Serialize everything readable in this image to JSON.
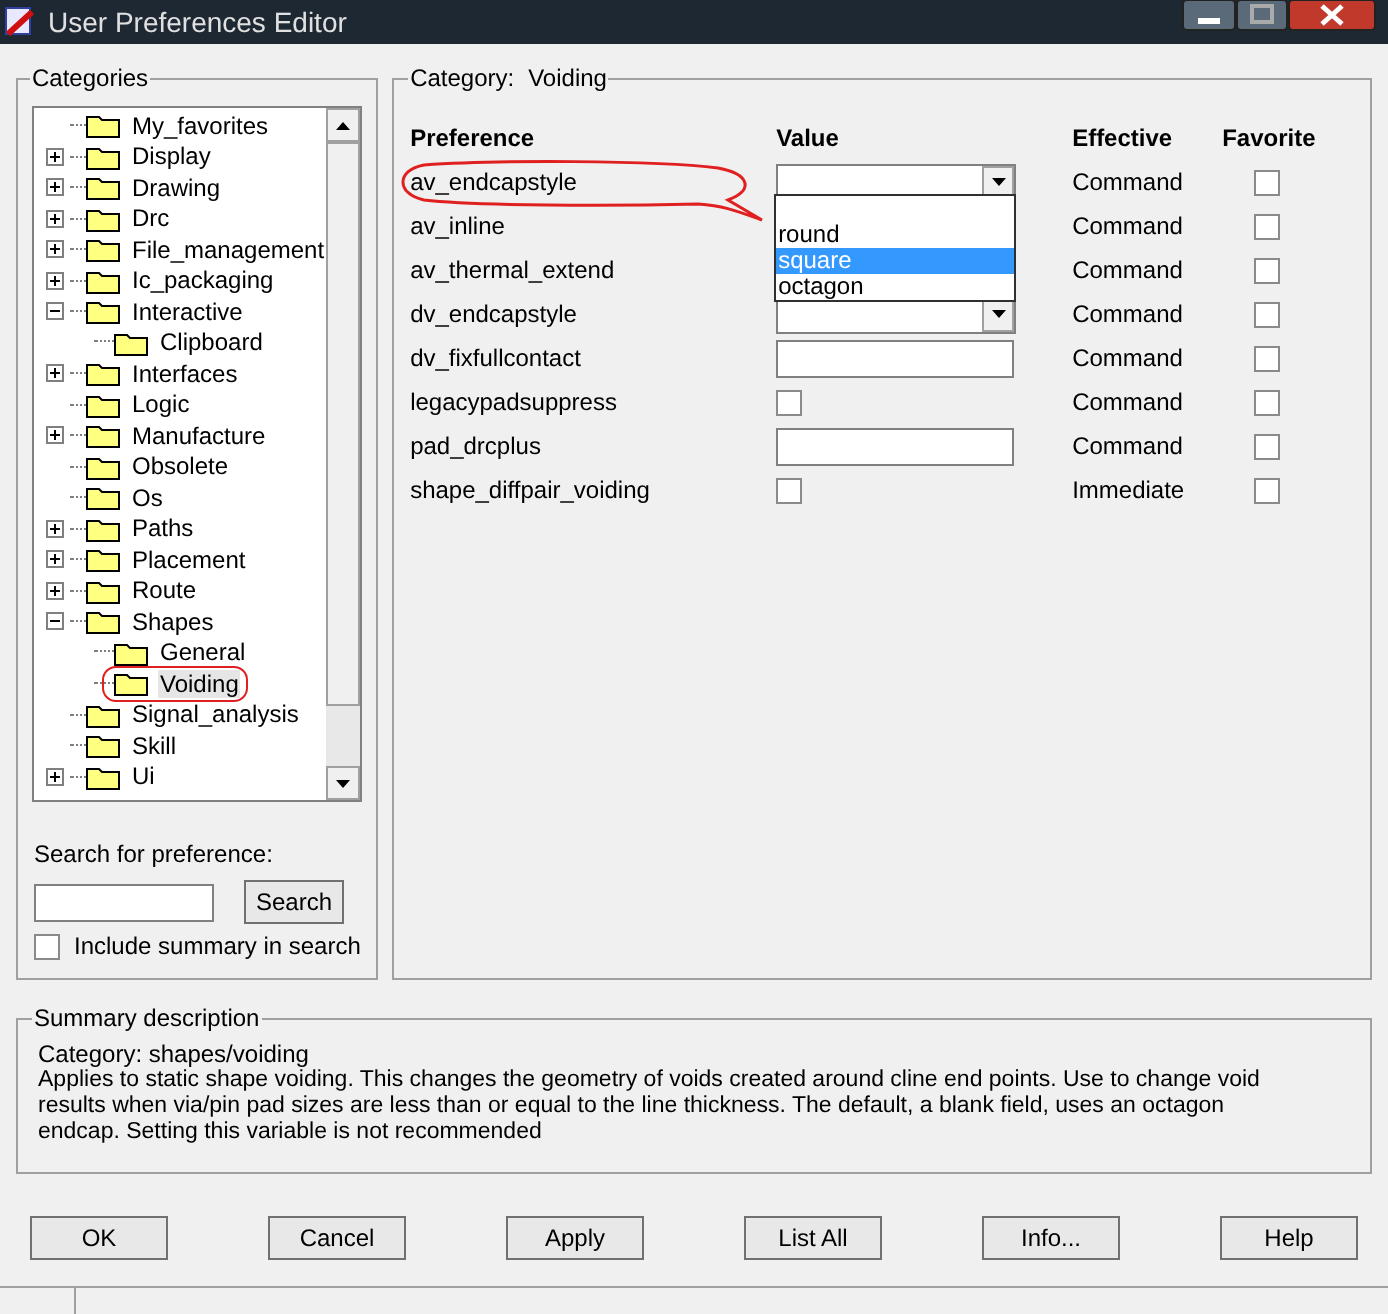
{
  "window": {
    "title": "User Preferences Editor"
  },
  "categories": {
    "title": "Categories",
    "tree": [
      {
        "label": "My_favorites",
        "selected": false
      },
      {
        "label": "Display",
        "expanded": false,
        "selected": false
      },
      {
        "label": "Drawing",
        "expanded": false,
        "selected": false
      },
      {
        "label": "Drc",
        "expanded": false,
        "selected": false
      },
      {
        "label": "File_management",
        "expanded": false,
        "selected": false
      },
      {
        "label": "Ic_packaging",
        "expanded": false,
        "selected": false
      },
      {
        "label": "Interactive",
        "expanded": true,
        "selected": false,
        "children": [
          {
            "label": "Clipboard",
            "selected": false
          }
        ]
      },
      {
        "label": "Interfaces",
        "expanded": false,
        "selected": false
      },
      {
        "label": "Logic",
        "selected": false
      },
      {
        "label": "Manufacture",
        "expanded": false,
        "selected": false
      },
      {
        "label": "Obsolete",
        "selected": false
      },
      {
        "label": "Os",
        "selected": false
      },
      {
        "label": "Paths",
        "expanded": false,
        "selected": false
      },
      {
        "label": "Placement",
        "expanded": false,
        "selected": false
      },
      {
        "label": "Route",
        "expanded": false,
        "selected": false
      },
      {
        "label": "Shapes",
        "expanded": true,
        "selected": false,
        "children": [
          {
            "label": "General",
            "selected": false,
            "circled": false
          },
          {
            "label": "Voiding",
            "selected": true,
            "circled": true
          }
        ]
      },
      {
        "label": "Signal_analysis",
        "selected": false
      },
      {
        "label": "Skill",
        "selected": false
      },
      {
        "label": "Ui",
        "expanded": false,
        "selected": false
      }
    ],
    "search_label": "Search for preference:",
    "search_button": "Search",
    "include_summary": {
      "label": "Include summary in search",
      "checked": false
    }
  },
  "preferences": {
    "category_label": "Category:",
    "category": "Voiding",
    "columns": [
      "Preference",
      "Value",
      "Effective",
      "Favorite"
    ],
    "rows": [
      {
        "name": "av_endcapstyle",
        "circled": true,
        "kind": "dropdown",
        "effective": "Command",
        "favorite": false
      },
      {
        "name": "av_inline",
        "circled": false,
        "kind": "covered",
        "effective": "Command",
        "favorite": false
      },
      {
        "name": "av_thermal_extend",
        "circled": false,
        "kind": "covered",
        "effective": "Command",
        "favorite": false
      },
      {
        "name": "dv_endcapstyle",
        "circled": false,
        "kind": "dropdown",
        "effective": "Command",
        "favorite": false
      },
      {
        "name": "dv_fixfullcontact",
        "circled": false,
        "kind": "text",
        "effective": "Command",
        "favorite": false
      },
      {
        "name": "legacypadsuppress",
        "circled": false,
        "kind": "checkbox",
        "checked": false,
        "effective": "Command",
        "favorite": false
      },
      {
        "name": "pad_drcplus",
        "circled": false,
        "kind": "text",
        "effective": "Command",
        "favorite": false
      },
      {
        "name": "shape_diffpair_voiding",
        "circled": false,
        "kind": "checkbox",
        "checked": false,
        "effective": "Immediate",
        "favorite": false
      }
    ],
    "open_list": [
      {
        "label": "round",
        "selected": false
      },
      {
        "label": "square",
        "selected": true
      },
      {
        "label": "octagon",
        "selected": false
      }
    ]
  },
  "summary": {
    "title": "Summary description",
    "category": "Category: shapes/voiding",
    "text": "Applies to static shape voiding. This changes the geometry of voids created around cline end points. Use to change void results when via/pin pad sizes are less than or equal to the line thickness. The default, a blank field, uses an octagon endcap. Setting this variable is not recommended"
  },
  "buttons": [
    "OK",
    "Cancel",
    "Apply",
    "List All",
    "Info...",
    "Help"
  ]
}
